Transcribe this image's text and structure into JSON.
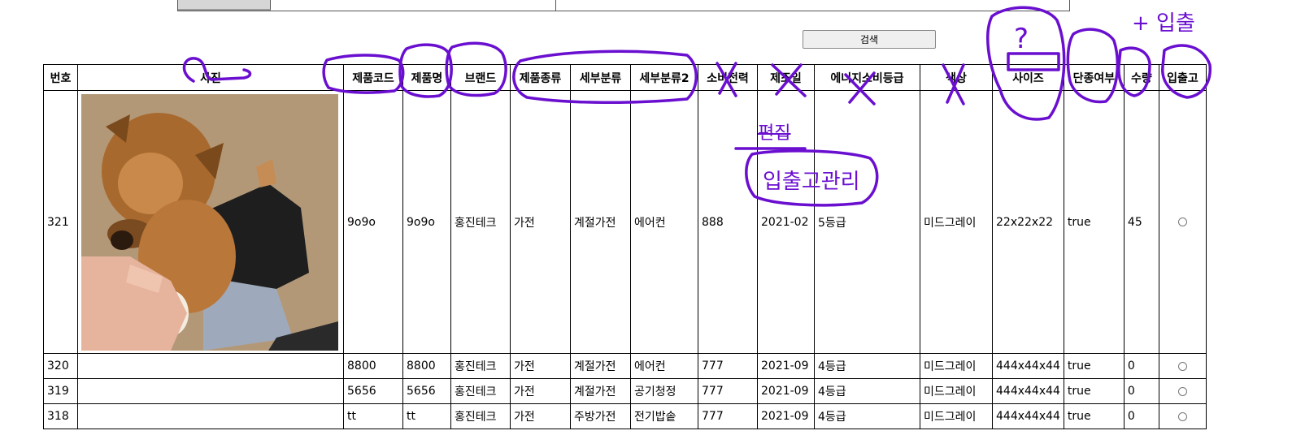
{
  "search": {
    "button_label": "검색"
  },
  "table": {
    "headers": [
      "번호",
      "사진",
      "제품코드",
      "제품명",
      "브랜드",
      "제품종류",
      "세부분류",
      "세부분류2",
      "소비전력",
      "제조일",
      "에너지소비등급",
      "색상",
      "사이즈",
      "단종여부",
      "수량",
      "입출고"
    ],
    "rows": [
      {
        "no": "321",
        "code": "9o9o",
        "name": "9o9o",
        "brand": "홍진테크",
        "type": "가전",
        "sub1": "계절가전",
        "sub2": "에어컨",
        "power": "888",
        "date": "2021-02",
        "energy": "5등급",
        "color": "미드그레이",
        "size": "22x22x22",
        "discontinued": "true",
        "qty": "45",
        "has_photo": true
      },
      {
        "no": "320",
        "code": "8800",
        "name": "8800",
        "brand": "홍진테크",
        "type": "가전",
        "sub1": "계절가전",
        "sub2": "에어컨",
        "power": "777",
        "date": "2021-09",
        "energy": "4등급",
        "color": "미드그레이",
        "size": "444x44x44",
        "discontinued": "true",
        "qty": "0",
        "has_photo": false
      },
      {
        "no": "319",
        "code": "5656",
        "name": "5656",
        "brand": "홍진테크",
        "type": "가전",
        "sub1": "계절가전",
        "sub2": "공기청정",
        "power": "777",
        "date": "2021-09",
        "energy": "4등급",
        "color": "미드그레이",
        "size": "444x44x44",
        "discontinued": "true",
        "qty": "0",
        "has_photo": false
      },
      {
        "no": "318",
        "code": "tt",
        "name": "tt",
        "brand": "홍진테크",
        "type": "가전",
        "sub1": "주방가전",
        "sub2": "전기밥솥",
        "power": "777",
        "date": "2021-09",
        "energy": "4등급",
        "color": "미드그레이",
        "size": "444x44x44",
        "discontinued": "true",
        "qty": "0",
        "has_photo": false
      }
    ]
  },
  "annotations": {
    "question_mark": "?",
    "plus_note": "+ 입출",
    "manage_note": "입출고관리",
    "manage_note_struck": "편집"
  },
  "colors": {
    "annotation": "#6a0fd0",
    "border": "#000000"
  }
}
